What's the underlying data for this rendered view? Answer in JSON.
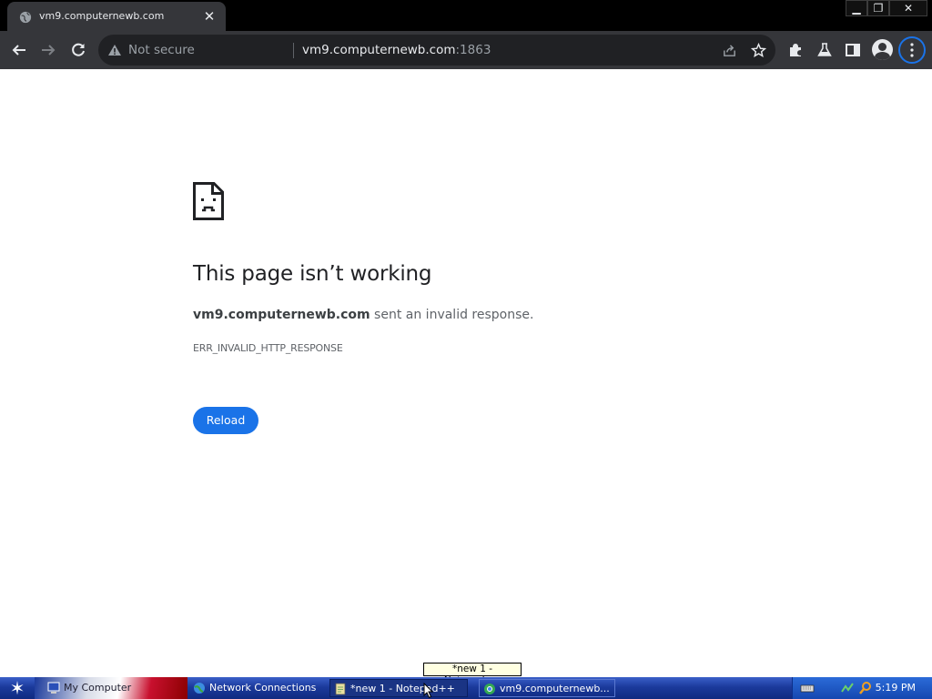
{
  "browser": {
    "tab_title": "vm9.computernewb.com",
    "security_label": "Not secure",
    "url_host": "vm9.computernewb.com",
    "url_port": ":1863"
  },
  "error_page": {
    "heading": "This page isn’t working",
    "host": "vm9.computernewb.com",
    "description_rest": " sent an invalid response.",
    "error_code": "ERR_INVALID_HTTP_RESPONSE",
    "reload_label": "Reload"
  },
  "taskbar": {
    "tooltip": "*new 1 - Notepad++",
    "tasks": [
      {
        "label": "My Computer",
        "icon": "my-computer-icon"
      },
      {
        "label": "Network Connections",
        "icon": "network-connections-icon"
      },
      {
        "label": "*new 1 - Notepad++",
        "icon": "notepad-plus-plus-icon"
      },
      {
        "label": "vm9.computernewb...",
        "icon": "chrome-icon"
      }
    ],
    "clock": "5:19 PM"
  },
  "colors": {
    "accent": "#1a73e8",
    "toolbar": "#35363a",
    "taskbar": "#1b3a9c"
  }
}
